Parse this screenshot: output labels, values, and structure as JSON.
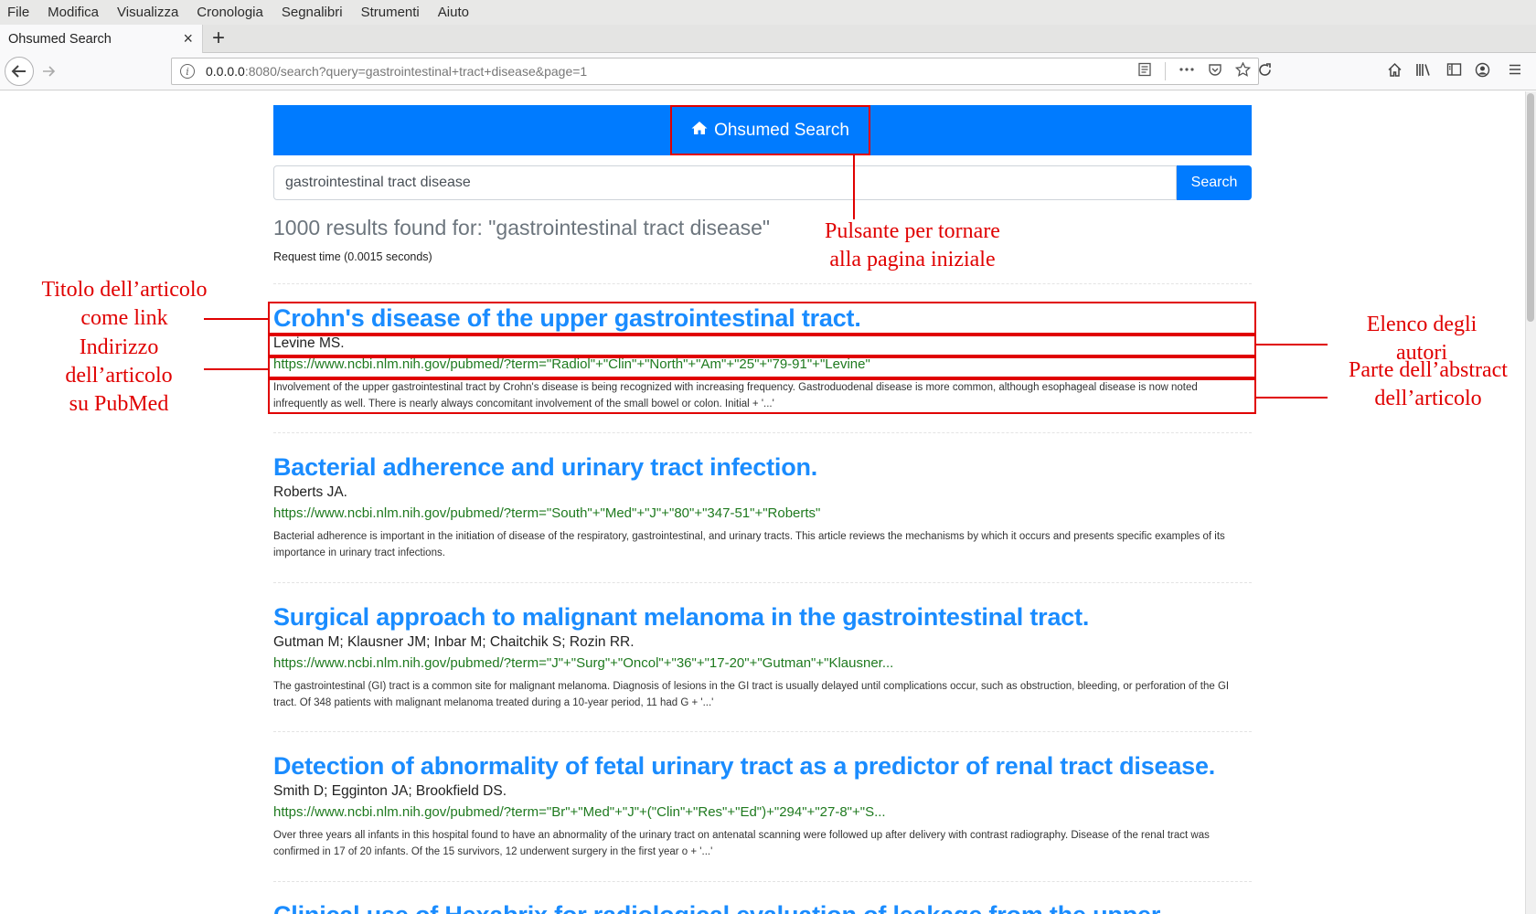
{
  "menubar": {
    "items": [
      "File",
      "Modifica",
      "Visualizza",
      "Cronologia",
      "Segnalibri",
      "Strumenti",
      "Aiuto"
    ]
  },
  "tab": {
    "title": "Ohsumed Search",
    "close": "×",
    "new_tab": "+"
  },
  "urlbar": {
    "host": "0.0.0.0",
    "rest": ":8080/search?query=gastrointestinal+tract+disease&page=1"
  },
  "header": {
    "home_label": "Ohsumed Search",
    "home_icon": "home-icon"
  },
  "search": {
    "value": "gastrointestinal tract disease",
    "button": "Search"
  },
  "summary": {
    "count_text": "1000 results found for: \"gastrointestinal tract disease\"",
    "request_time": "Request time (0.0015 seconds)"
  },
  "results": [
    {
      "title": "Crohn's disease of the upper gastrointestinal tract.",
      "authors": "Levine MS.",
      "url": "https://www.ncbi.nlm.nih.gov/pubmed/?term=\"Radiol\"+\"Clin\"+\"North\"+\"Am\"+\"25\"+\"79-91\"+\"Levine\"",
      "abstract": "Involvement of the upper gastrointestinal tract by Crohn's disease is being recognized with increasing frequency. Gastroduodenal disease is more common, although esophageal disease is now noted infrequently as well. There is nearly always concomitant involvement of the small bowel or colon. Initial + '...'"
    },
    {
      "title": "Bacterial adherence and urinary tract infection.",
      "authors": "Roberts JA.",
      "url": "https://www.ncbi.nlm.nih.gov/pubmed/?term=\"South\"+\"Med\"+\"J\"+\"80\"+\"347-51\"+\"Roberts\"",
      "abstract": "Bacterial adherence is important in the initiation of disease of the respiratory, gastrointestinal, and urinary tracts. This article reviews the mechanisms by which it occurs and presents specific examples of its importance in urinary tract infections."
    },
    {
      "title": "Surgical approach to malignant melanoma in the gastrointestinal tract.",
      "authors": "Gutman M; Klausner JM; Inbar M; Chaitchik S; Rozin RR.",
      "url": "https://www.ncbi.nlm.nih.gov/pubmed/?term=\"J\"+\"Surg\"+\"Oncol\"+\"36\"+\"17-20\"+\"Gutman\"+\"Klausner...",
      "abstract": "The gastrointestinal (GI) tract is a common site for malignant melanoma. Diagnosis of lesions in the GI tract is usually delayed until complications occur, such as obstruction, bleeding, or perforation of the GI tract. Of 348 patients with malignant melanoma treated during a 10-year period, 11 had G + '...'"
    },
    {
      "title": "Detection of abnormality of fetal urinary tract as a predictor of renal tract disease.",
      "authors": "Smith D; Egginton JA; Brookfield DS.",
      "url": "https://www.ncbi.nlm.nih.gov/pubmed/?term=\"Br\"+\"Med\"+\"J\"+(\"Clin\"+\"Res\"+\"Ed\")+\"294\"+\"27-8\"+\"S...",
      "abstract": "Over three years all infants in this hospital found to have an abnormality of the urinary tract on antenatal scanning were followed up after delivery with contrast radiography. Disease of the renal tract was confirmed in 17 of 20 infants. Of the 15 survivors, 12 underwent surgery in the first year o + '...'"
    },
    {
      "title": "Clinical use of Hexabrix for radiological evaluation of leakage from the upper",
      "authors": "",
      "url": "",
      "abstract": ""
    }
  ],
  "annotations": {
    "home": "Pulsante  per  tornare\nalla  pagina  iniziale",
    "title": "Titolo  dell’articolo\ncome  link",
    "address": "Indirizzo\ndell’articolo\nsu  PubMed",
    "authors": "Elenco  degli\nautori",
    "abstract": "Parte  dell’abstract\ndell’articolo"
  },
  "colors": {
    "accent": "#007bff",
    "title_link": "#1a8cff",
    "url_green": "#1f7a1f",
    "annotation_red": "#e00000"
  }
}
